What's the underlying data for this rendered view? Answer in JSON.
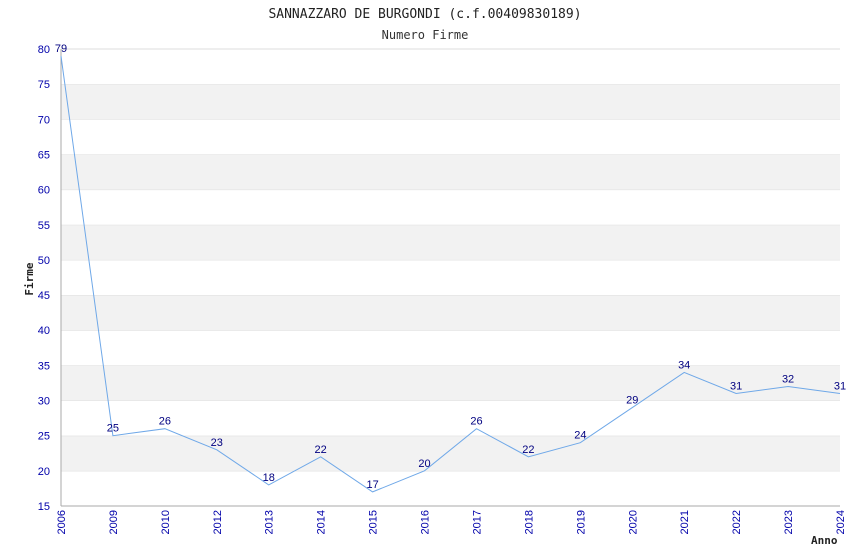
{
  "chart_data": {
    "type": "line",
    "title": "SANNAZZARO DE BURGONDI (c.f.00409830189)",
    "subtitle": "Numero Firme",
    "xlabel": "Anno",
    "ylabel": "Firme",
    "categories": [
      "2006",
      "2009",
      "2010",
      "2012",
      "2013",
      "2014",
      "2015",
      "2016",
      "2017",
      "2018",
      "2019",
      "2020",
      "2021",
      "2022",
      "2023",
      "2024"
    ],
    "series": [
      {
        "values": [
          79,
          25,
          26,
          23,
          18,
          22,
          17,
          20,
          26,
          22,
          24,
          29,
          34,
          31,
          32,
          31
        ]
      }
    ],
    "ylim": [
      15,
      80
    ],
    "ytick_step": 5,
    "grid": "horizontal bands",
    "colors": {
      "line": "#6fa8e8",
      "tick": "#0000aa",
      "band": "#f2f2f2",
      "grid": "#dddddd"
    }
  }
}
